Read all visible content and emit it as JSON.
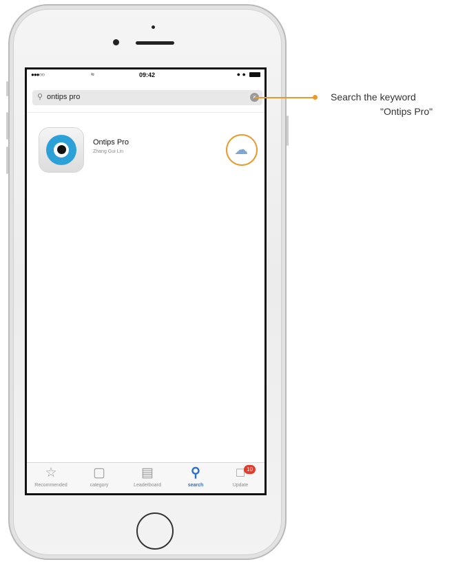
{
  "status_bar": {
    "signal": "●●●○○",
    "wifi_icon": "wifi-icon",
    "time": "09:42",
    "alarm_icon": "alarm-icon",
    "battery_icon": "battery-icon"
  },
  "search": {
    "query": "ontips pro",
    "icon": "search-icon",
    "clear_icon": "clear-icon"
  },
  "results": [
    {
      "name": "Ontips Pro",
      "developer": "Zhang Gui Lin",
      "icon": "ontips-app-icon",
      "action_icon": "cloud-download-icon"
    }
  ],
  "tab_bar": {
    "tabs": [
      {
        "label": "Recommended",
        "icon": "star-icon"
      },
      {
        "label": "category",
        "icon": "category-icon"
      },
      {
        "label": "Leaderboard",
        "icon": "list-icon"
      },
      {
        "label": "search",
        "icon": "search-icon",
        "active": true
      },
      {
        "label": "Update",
        "icon": "update-icon",
        "badge": "10"
      }
    ]
  },
  "callout": {
    "line1": "Search the keyword",
    "line2": "\"Ontips Pro\""
  },
  "colors": {
    "accent": "#e99a2a",
    "active_tab": "#2b6fd6",
    "badge": "#e53b2c",
    "app_icon": "#2ba1d8"
  }
}
